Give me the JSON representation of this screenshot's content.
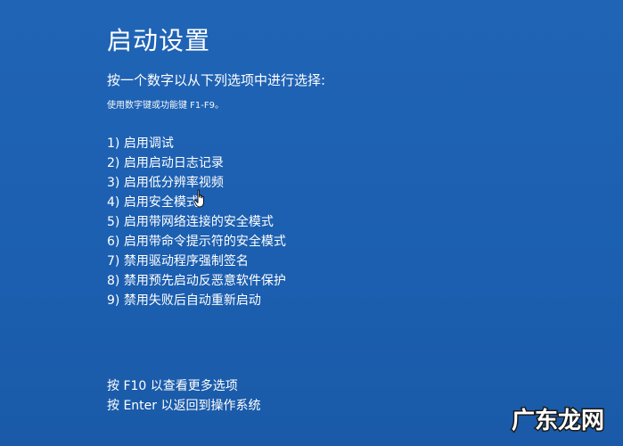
{
  "screen": {
    "title": "启动设置",
    "instruction": "按一个数字以从下列选项中进行选择:",
    "hint": "使用数字键或功能键 F1-F9。",
    "options": [
      "1) 启用调试",
      "2) 启用启动日志记录",
      "3) 启用低分辨率视频",
      "4) 启用安全模式",
      "5) 启用带网络连接的安全模式",
      "6) 启用带命令提示符的安全模式",
      "7) 禁用驱动程序强制签名",
      "8) 禁用预先启动反恶意软件保护",
      "9) 禁用失败后自动重新启动"
    ],
    "footer": {
      "more_options": "按 F10 以查看更多选项",
      "return": "按 Enter 以返回到操作系统"
    }
  },
  "watermark": {
    "text": "广东龙网"
  },
  "colors": {
    "background": "#1d5fb2",
    "text": "#ffffff"
  },
  "icons": {
    "cursor": "hand-pointer-icon"
  }
}
